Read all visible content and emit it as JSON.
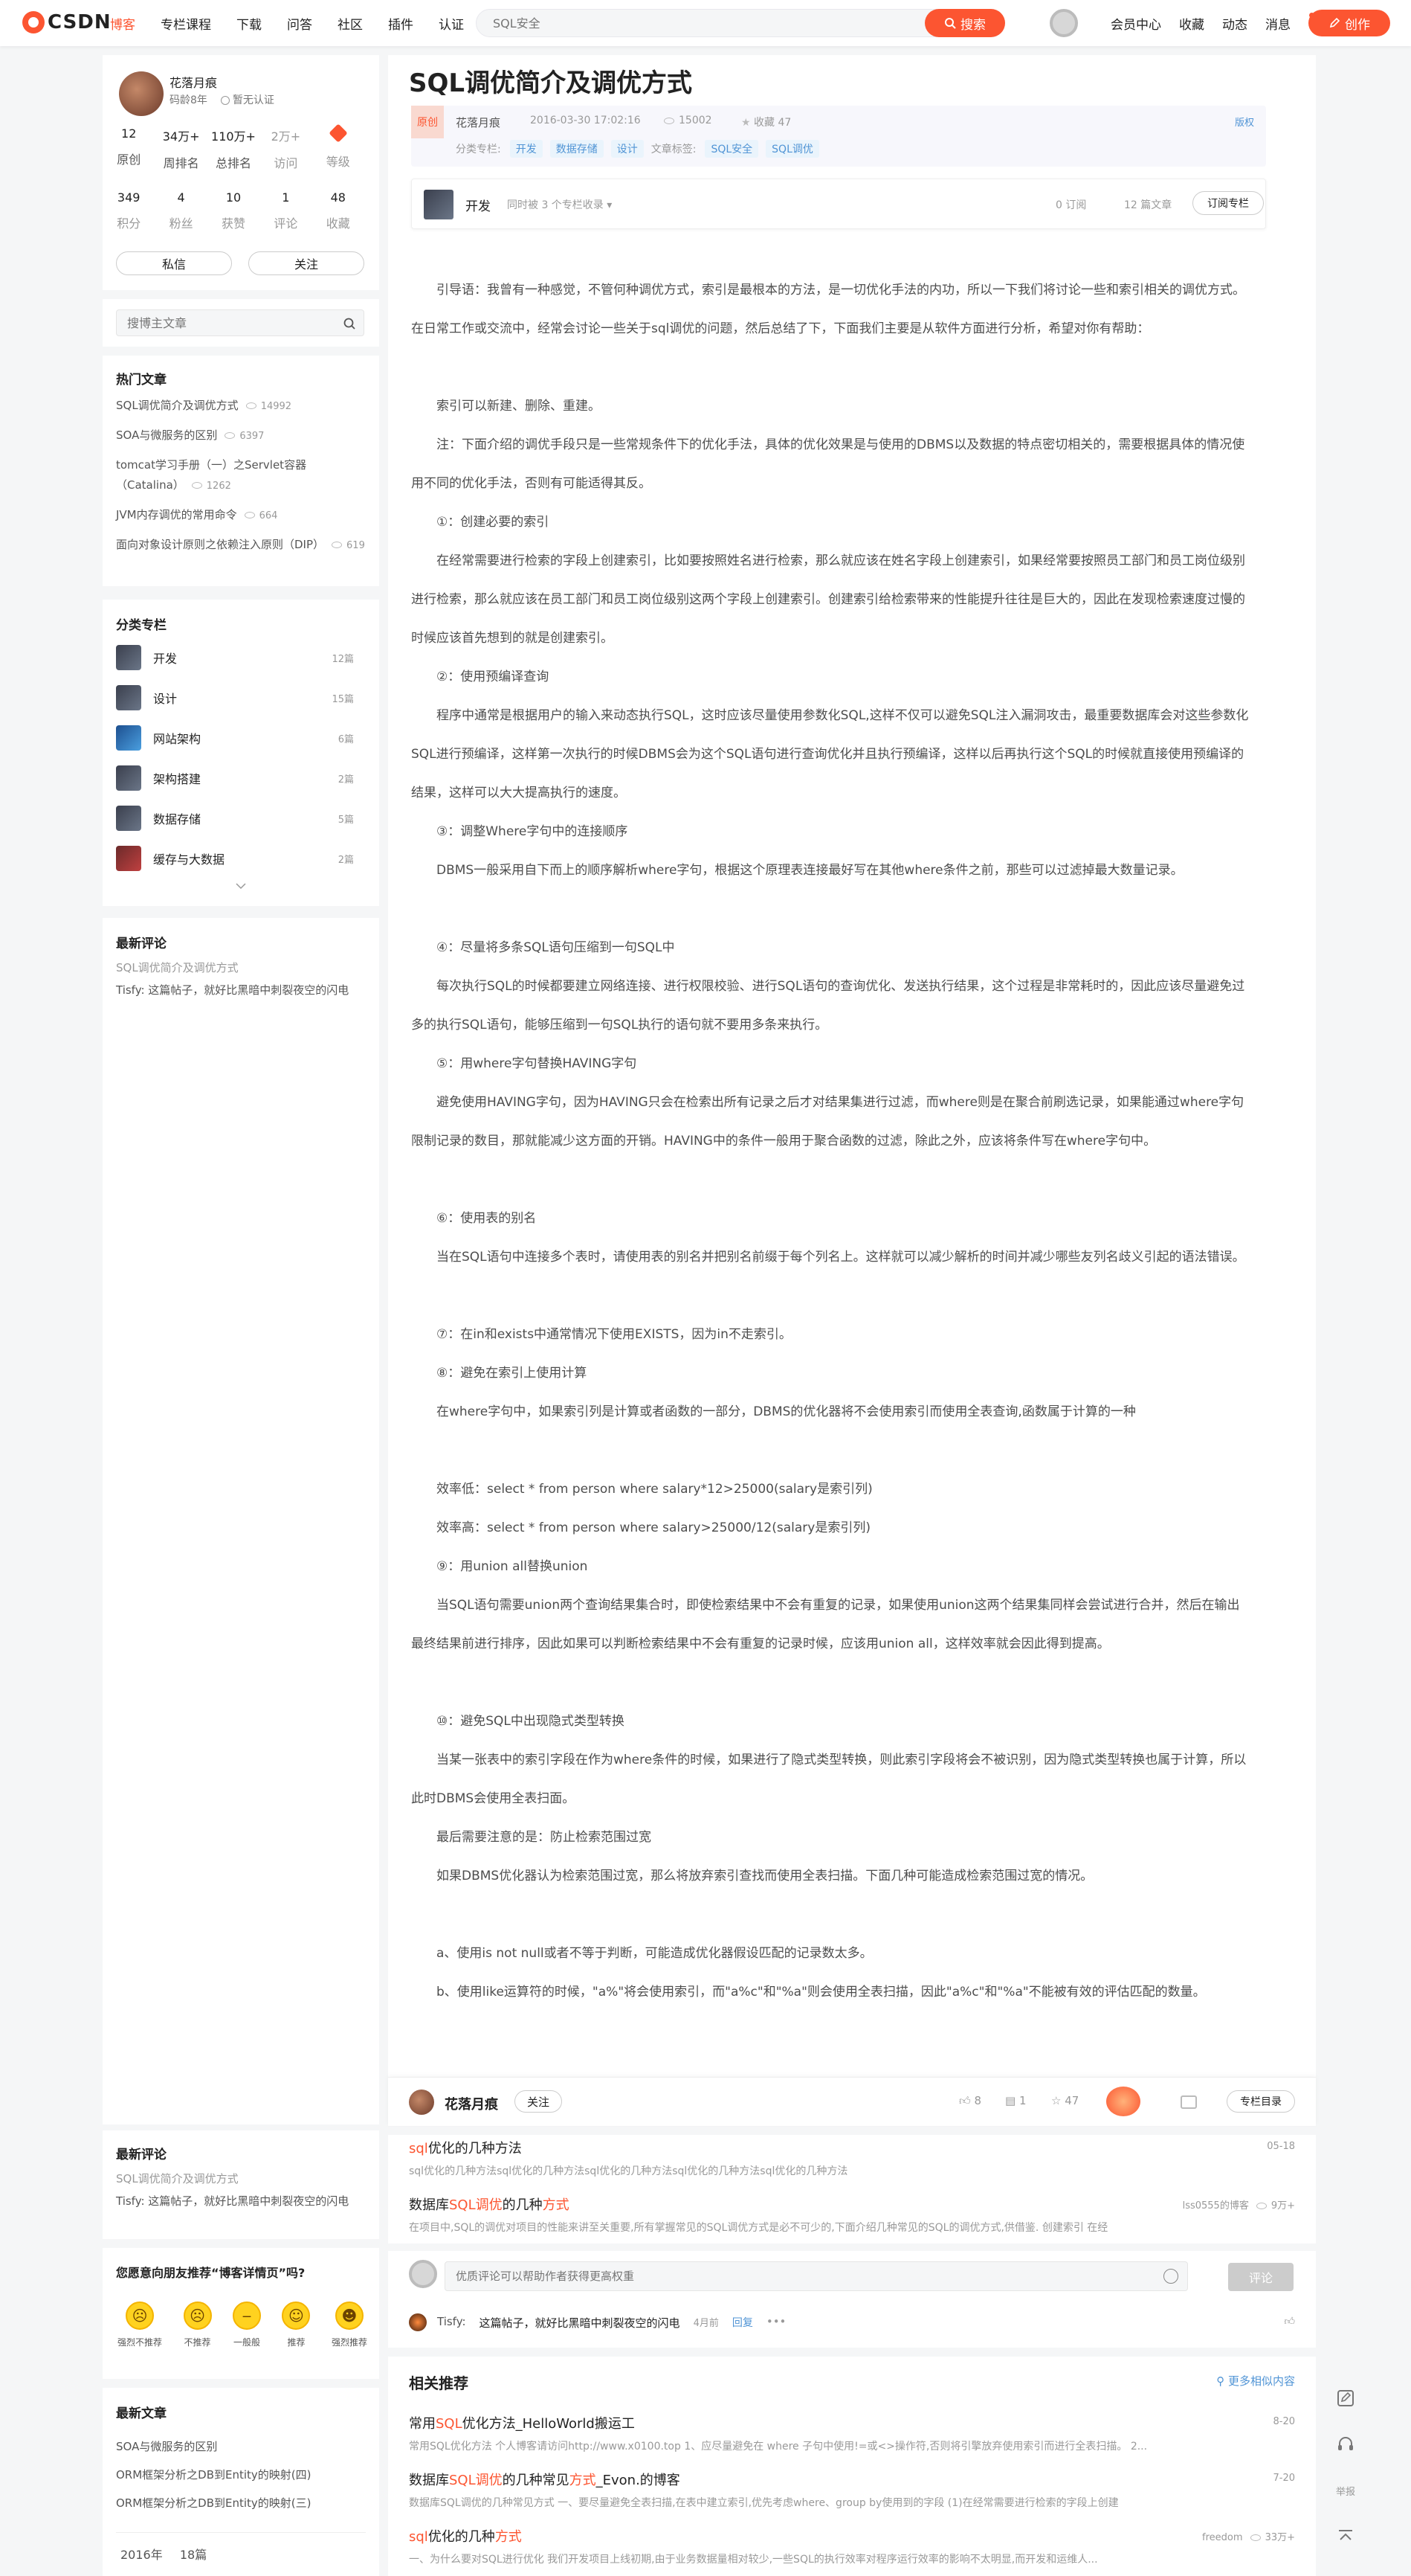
{
  "header": {
    "logo": "CSDN",
    "nav": [
      "博客",
      "专栏课程",
      "下载",
      "问答",
      "社区",
      "插件",
      "认证"
    ],
    "search_placeholder": "SQL安全",
    "search_button": "搜索",
    "right": [
      "会员中心",
      "收藏",
      "动态",
      "消息"
    ],
    "create": "创作"
  },
  "profile": {
    "name": "花落月痕",
    "age": "码龄8年",
    "cert": "暂无认证",
    "stats1": [
      {
        "num": "12",
        "label": "原创"
      },
      {
        "num": "34万+",
        "label": "周排名"
      },
      {
        "num": "110万+",
        "label": "总排名"
      },
      {
        "num": "2万+",
        "label": "访问"
      },
      {
        "num": "",
        "label": "等级"
      }
    ],
    "stats2": [
      {
        "num": "349",
        "label": "积分"
      },
      {
        "num": "4",
        "label": "粉丝"
      },
      {
        "num": "10",
        "label": "获赞"
      },
      {
        "num": "1",
        "label": "评论"
      },
      {
        "num": "48",
        "label": "收藏"
      }
    ],
    "msg_btn": "私信",
    "follow_btn": "关注"
  },
  "blog_search": {
    "placeholder": "搜博主文章"
  },
  "hot": {
    "title": "热门文章",
    "items": [
      {
        "title": "SQL调优简介及调优方式",
        "count": "14992"
      },
      {
        "title": "SOA与微服务的区别",
        "count": "6397"
      },
      {
        "title": "tomcat学习手册（一）之Servlet容器（Catalina）",
        "count": "1262"
      },
      {
        "title": "JVM内存调优的常用命令",
        "count": "664"
      },
      {
        "title": "面向对象设计原则之依赖注入原则（DIP）",
        "count": "619"
      }
    ]
  },
  "columns": {
    "title": "分类专栏",
    "items": [
      {
        "name": "开发",
        "count": "12篇"
      },
      {
        "name": "设计",
        "count": "15篇"
      },
      {
        "name": "网站架构",
        "count": "6篇"
      },
      {
        "name": "架构搭建",
        "count": "2篇"
      },
      {
        "name": "数据存储",
        "count": "5篇"
      },
      {
        "name": "缓存与大数据",
        "count": "2篇"
      }
    ]
  },
  "recent_comments": {
    "title": "最新评论",
    "article": "SQL调优简介及调优方式",
    "comment": "Tisfy: 这篇帖子，就好比黑暗中刺裂夜空的闪电"
  },
  "recommend_survey": {
    "title": "您愿意向朋友推荐“博客详情页”吗?",
    "options": [
      "强烈不推荐",
      "不推荐",
      "一般般",
      "推荐",
      "强烈推荐"
    ]
  },
  "latest_articles": {
    "title": "最新文章",
    "items": [
      "SOA与微服务的区别",
      "ORM框架分析之DB到Entity的映射(四)",
      "ORM框架分析之DB到Entity的映射(三)"
    ],
    "archive_year": "2016年",
    "archive_count": "18篇"
  },
  "article": {
    "title": "SQL调优简介及调优方式",
    "badge": "原创",
    "author": "花落月痕",
    "date": "2016-03-30 17:02:16",
    "views": "15002",
    "favorites": "收藏 47",
    "copyright": "版权",
    "category_label": "分类专栏:",
    "categories": [
      "开发",
      "数据存储",
      "设计"
    ],
    "tags_label": "文章标签:",
    "tags": [
      "SQL安全",
      "SQL调优"
    ],
    "column_name": "开发",
    "column_note": "同时被 3 个专栏收录",
    "column_subs": "0 订阅",
    "column_articles": "12 篇文章",
    "subscribe": "订阅专栏",
    "paragraphs": [
      "引导语：我曾有一种感觉，不管何种调优方式，索引是最根本的方法，是一切优化手法的内功，所以一下我们将讨论一些和索引相关的调优方式。在日常工作或交流中，经常会讨论一些关于sql调优的问题，然后总结了下，下面我们主要是从软件方面进行分析，希望对你有帮助：",
      "索引可以新建、删除、重建。",
      "注：下面介绍的调优手段只是一些常规条件下的优化手法，具体的优化效果是与使用的DBMS以及数据的特点密切相关的，需要根据具体的情况使用不同的优化手法，否则有可能适得其反。",
      "①：创建必要的索引",
      "在经常需要进行检索的字段上创建索引，比如要按照姓名进行检索，那么就应该在姓名字段上创建索引，如果经常要按照员工部门和员工岗位级别进行检索，那么就应该在员工部门和员工岗位级别这两个字段上创建索引。创建索引给检索带来的性能提升往往是巨大的，因此在发现检索速度过慢的时候应该首先想到的就是创建索引。",
      "②：使用预编译查询",
      "程序中通常是根据用户的输入来动态执行SQL，这时应该尽量使用参数化SQL,这样不仅可以避免SQL注入漏洞攻击，最重要数据库会对这些参数化SQL进行预编译，这样第一次执行的时候DBMS会为这个SQL语句进行查询优化并且执行预编译，这样以后再执行这个SQL的时候就直接使用预编译的结果，这样可以大大提高执行的速度。",
      "③：调整Where字句中的连接顺序",
      "DBMS一般采用自下而上的顺序解析where字句，根据这个原理表连接最好写在其他where条件之前，那些可以过滤掉最大数量记录。",
      "④：尽量将多条SQL语句压缩到一句SQL中",
      "每次执行SQL的时候都要建立网络连接、进行权限校验、进行SQL语句的查询优化、发送执行结果，这个过程是非常耗时的，因此应该尽量避免过多的执行SQL语句，能够压缩到一句SQL执行的语句就不要用多条来执行。",
      "⑤：用where字句替换HAVING字句",
      "避免使用HAVING字句，因为HAVING只会在检索出所有记录之后才对结果集进行过滤，而where则是在聚合前刷选记录，如果能通过where字句限制记录的数目，那就能减少这方面的开销。HAVING中的条件一般用于聚合函数的过滤，除此之外，应该将条件写在where字句中。",
      "⑥：使用表的别名",
      "当在SQL语句中连接多个表时，请使用表的别名并把别名前缀于每个列名上。这样就可以减少解析的时间并减少哪些友列名歧义引起的语法错误。",
      "⑦：在in和exists中通常情况下使用EXISTS，因为in不走索引。",
      "⑧：避免在索引上使用计算",
      "在where字句中，如果索引列是计算或者函数的一部分，DBMS的优化器将不会使用索引而使用全表查询,函数属于计算的一种",
      "效率低：select * from person where salary*12>25000(salary是索引列)",
      "效率高：select * from person where salary>25000/12(salary是索引列)",
      "⑨：用union all替换union",
      "当SQL语句需要union两个查询结果集合时，即使检索结果中不会有重复的记录，如果使用union这两个结果集同样会尝试进行合并，然后在输出最终结果前进行排序，因此如果可以判断检索结果中不会有重复的记录时候，应该用union all，这样效率就会因此得到提高。",
      "⑩：避免SQL中出现隐式类型转换",
      "当某一张表中的索引字段在作为where条件的时候，如果进行了隐式类型转换，则此索引字段将会不被识别，因为隐式类型转换也属于计算，所以此时DBMS会使用全表扫面。",
      "最后需要注意的是：防止检索范围过宽",
      "如果DBMS优化器认为检索范围过宽，那么将放弃索引查找而使用全表扫描。下面几种可能造成检索范围过宽的情况。",
      "a、使用is not null或者不等于判断，可能造成优化器假设匹配的记录数太多。",
      "b、使用like运算符的时候，\"a%\"将会使用索引，而\"a%c\"和\"%a\"则会使用全表扫描，因此\"a%c\"和\"%a\"不能被有效的评估匹配的数量。"
    ]
  },
  "footer_bar": {
    "author": "花落月痕",
    "follow": "关注",
    "likes": "8",
    "comments": "1",
    "stars": "47",
    "column_dir": "专栏目录"
  },
  "recommend_top": [
    {
      "title_parts": [
        "sql",
        "优化的几种方法"
      ],
      "desc": "sql优化的几种方法sql优化的几种方法sql优化的几种方法sql优化的几种方法sql优化的几种方法",
      "date": "05-18"
    },
    {
      "title_parts": [
        "数据库",
        "SQL调优",
        "的几种",
        "方式"
      ],
      "desc": "在项目中,SQL的调优对项目的性能来讲至关重要,所有掌握常见的SQL调优方式是必不可少的,下面介绍几种常见的SQL的调优方式,供借鉴. 创建索引 在经",
      "author": "lss0555的博客",
      "views": "9万+"
    }
  ],
  "comment_input": {
    "placeholder": "优质评论可以帮助作者获得更高权重",
    "submit": "评论"
  },
  "comment": {
    "user": "Tisfy:",
    "text": "这篇帖子，就好比黑暗中刺裂夜空的闪电",
    "time": "4月前",
    "reply": "回复"
  },
  "related": {
    "title": "相关推荐",
    "more": "更多相似内容",
    "items": [
      {
        "title_parts": [
          "常用",
          "SQL",
          "优化方法_HelloWorld搬运工"
        ],
        "desc": "常用SQL优化方法 个人博客请访问http://www.x0100.top 1、应尽量避免在 where 子句中使用!=或<>操作符,否则将引擎放弃使用索引而进行全表扫描。 2...",
        "date": "8-20"
      },
      {
        "title_parts": [
          "数据库",
          "SQL调优",
          "的几种常见",
          "方式",
          "_Evon.的博客"
        ],
        "desc": "数据库SQL调优的几种常见方式 一、要尽量避免全表扫描,在表中建立索引,优先考虑where、group by使用到的字段 (1)在经常需要进行检索的字段上创建",
        "date": "7-20"
      },
      {
        "title_parts": [
          "sql",
          "优化的几种",
          "方式"
        ],
        "desc": "一、为什么要对SQL进行优化 我们开发项目上线初期,由于业务数据量相对较少,一些SQL的执行效率对程序运行效率的影响不太明显,而开发和运维人...",
        "author": "freedom",
        "views": "33万+"
      }
    ]
  },
  "float": {
    "report": "举报"
  }
}
